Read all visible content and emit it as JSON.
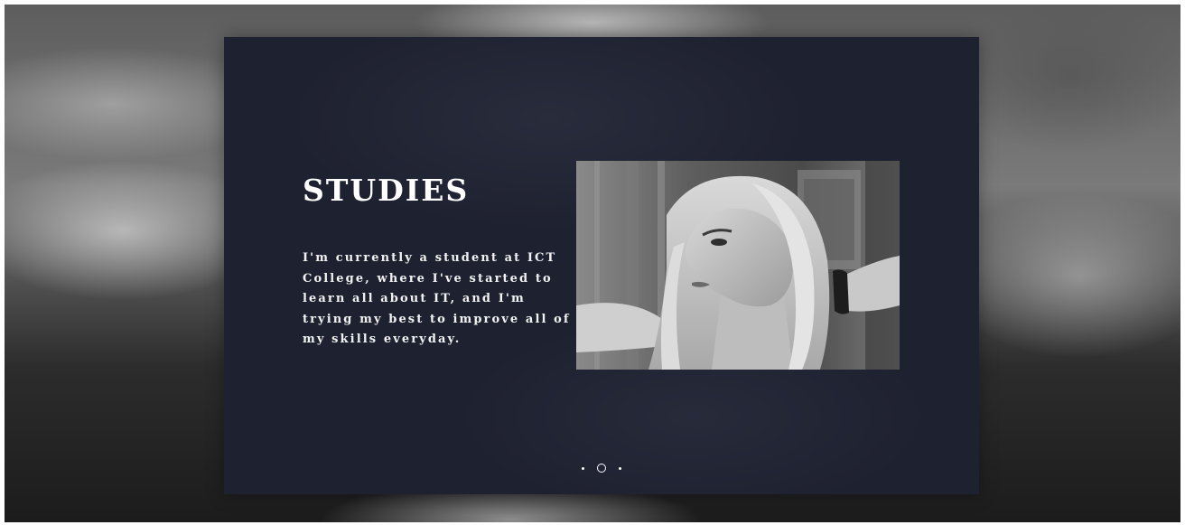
{
  "section": {
    "heading": "STUDIES",
    "description": "I'm currently a student at ICT College, where I've started to learn all about IT, and I'm trying my best to improve all of my skills everyday."
  },
  "slider": {
    "count": 3,
    "active_index": 1
  },
  "colors": {
    "panel_background": "#1e2130",
    "text": "#ffffff"
  }
}
